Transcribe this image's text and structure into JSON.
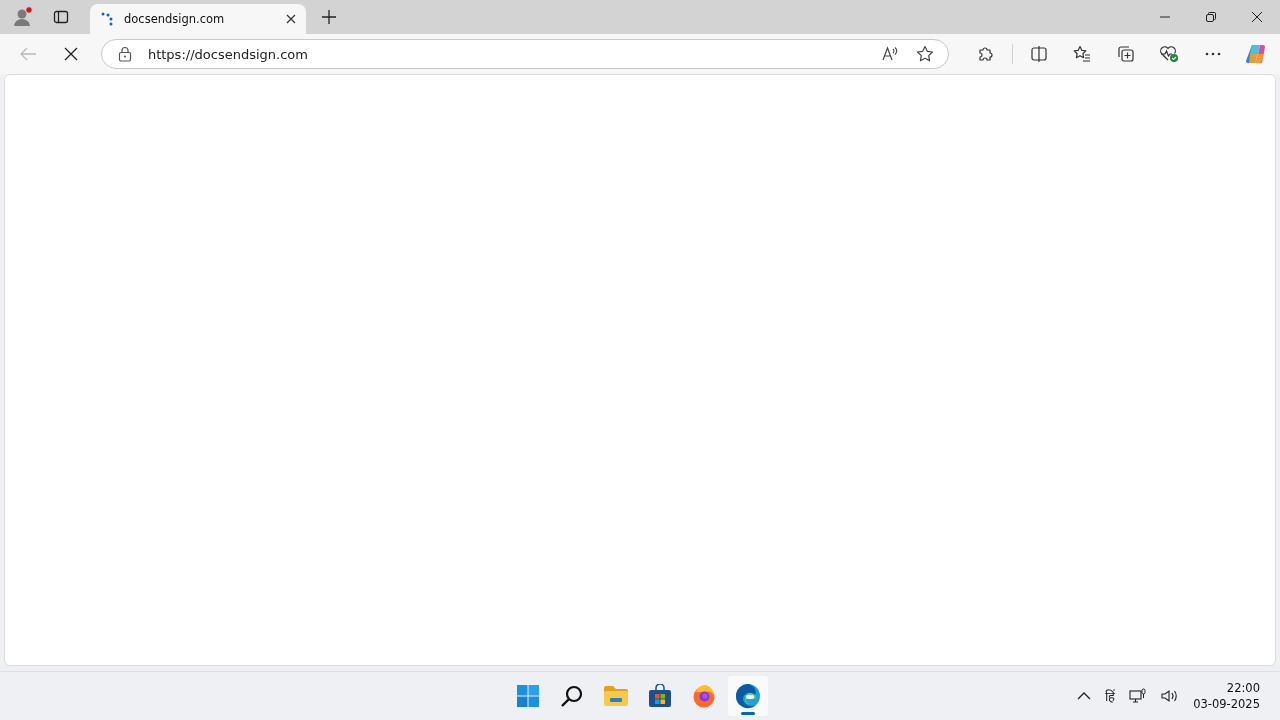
{
  "profile": {
    "notification": true
  },
  "tabs": [
    {
      "title": "docsendsign.com",
      "selected": true,
      "loading": true
    }
  ],
  "navigation": {
    "back_disabled": true,
    "loading": true
  },
  "address_bar": {
    "url": "https://docsendsign.com"
  },
  "taskbar": {
    "apps": [
      {
        "kind": "start",
        "selected": false
      },
      {
        "kind": "search",
        "selected": false
      },
      {
        "kind": "explorer",
        "selected": false
      },
      {
        "kind": "store",
        "selected": false
      },
      {
        "kind": "firefox",
        "selected": false
      },
      {
        "kind": "edge",
        "selected": true
      }
    ]
  },
  "tray": {
    "language": "हिं",
    "time": "22:00",
    "date": "03-09-2025"
  }
}
